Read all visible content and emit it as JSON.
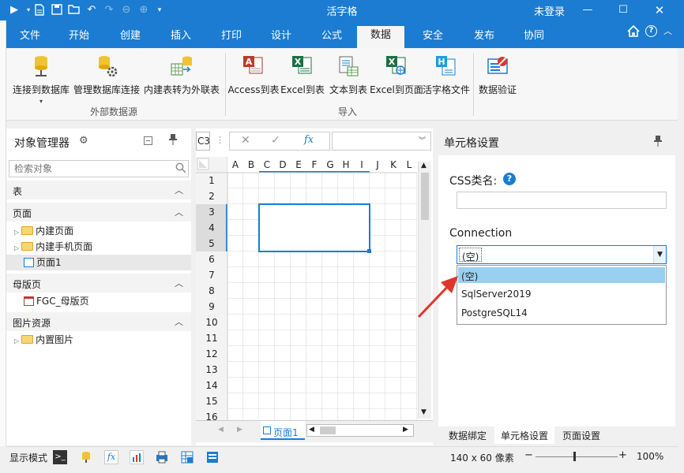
{
  "app": {
    "title": "活字格",
    "login": "未登录",
    "help_glyph": "?"
  },
  "menu": {
    "tabs": [
      "文件",
      "开始",
      "创建",
      "插入",
      "打印",
      "设计",
      "公式",
      "数据",
      "安全",
      "发布",
      "协同"
    ],
    "active": "数据"
  },
  "ribbon": {
    "buttons": [
      {
        "label": "连接到数据库"
      },
      {
        "label": "管理数据库连接"
      },
      {
        "label": "内建表转为外联表"
      },
      {
        "label": "Access到表"
      },
      {
        "label": "Excel到表"
      },
      {
        "label": "文本到表"
      },
      {
        "label": "Excel到页面"
      },
      {
        "label": "活字格文件"
      },
      {
        "label": "数据验证"
      }
    ],
    "groups": [
      "外部数据源",
      "导入"
    ]
  },
  "left_panel": {
    "title": "对象管理器",
    "search_placeholder": "检索对象",
    "sections": {
      "table": "表",
      "pages": "页面",
      "pages_items": [
        "内建页面",
        "内建手机页面",
        "页面1"
      ],
      "master": "母版页",
      "master_items": [
        "FGC_母版页"
      ],
      "images": "图片资源",
      "images_items": [
        "内置图片"
      ]
    }
  },
  "grid": {
    "name_box": "C3",
    "columns": [
      "A",
      "B",
      "C",
      "D",
      "E",
      "F",
      "G",
      "H",
      "I",
      "J",
      "K",
      "L"
    ],
    "rows": [
      "1",
      "2",
      "3",
      "4",
      "5",
      "6",
      "7",
      "8",
      "9",
      "10",
      "11",
      "12",
      "13",
      "14",
      "15",
      "16"
    ],
    "sheet_tab": "页面1",
    "fx_label": "fx"
  },
  "right_panel": {
    "title": "单元格设置",
    "css_label": "CSS类名:",
    "css_value": "",
    "connection_label": "Connection",
    "connection_value": "(空)",
    "options": [
      "(空)",
      "SqlServer2019",
      "PostgreSQL14"
    ],
    "bottom_tabs": [
      "数据绑定",
      "单元格设置",
      "页面设置"
    ],
    "active_tab": "单元格设置"
  },
  "status": {
    "mode_label": "显示模式",
    "size_label": "140 x 60 像素",
    "zoom": "100%",
    "zoom_minus": "−",
    "zoom_plus": "+"
  },
  "colors": {
    "accent": "#1b7cd1",
    "selection": "#1b7cd1",
    "dropdown_highlight": "#99d0f2",
    "arrow": "#e0352b"
  }
}
